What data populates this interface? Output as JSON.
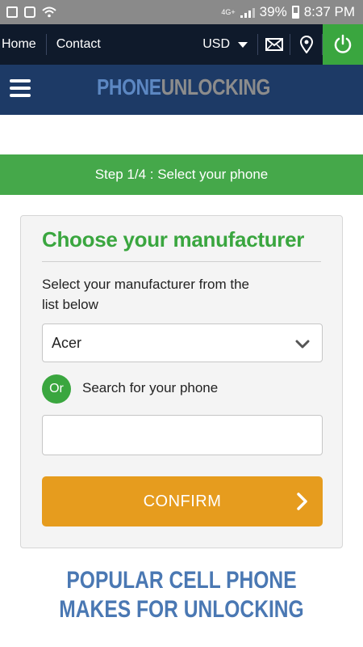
{
  "status_bar": {
    "network": "4G+",
    "battery": "39%",
    "time": "8:37 PM",
    "icons": [
      "gallery-icon",
      "recycle-icon",
      "wifi-icon",
      "signal-icon",
      "battery-icon"
    ]
  },
  "nav": {
    "home": "Home",
    "contact": "Contact",
    "currency": "USD",
    "icons": [
      "mail-icon",
      "location-pin-icon",
      "power-icon"
    ]
  },
  "brand": {
    "logo_part1": "PHONE",
    "logo_part2": "UNLOCKING"
  },
  "step": {
    "label": "Step 1/4 : Select your phone"
  },
  "card": {
    "title": "Choose your manufacturer",
    "subtitle": "Select your manufacturer from the list below",
    "manufacturer_selected": "Acer",
    "or_label": "Or",
    "search_label": "Search for your phone",
    "search_value": "",
    "confirm_label": "CONFIRM"
  },
  "popular": {
    "heading": "Popular cell phone makes for unlocking"
  },
  "colors": {
    "nav_bg": "#0f1a2b",
    "brand_bg": "#1d3a66",
    "green": "#45a84a",
    "orange": "#e69c1e",
    "heading_blue": "#4a78b3"
  }
}
